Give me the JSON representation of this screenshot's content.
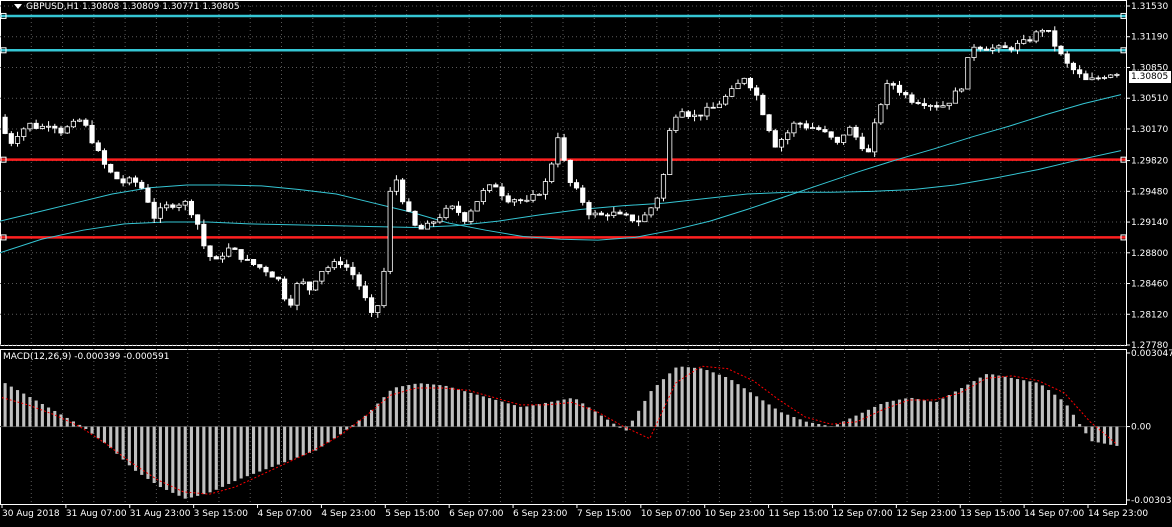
{
  "header": {
    "symbol": "GBPUSD,H1",
    "open": "1.30808",
    "high": "1.30809",
    "low": "1.30771",
    "close": "1.30805"
  },
  "current_price_label": "1.30805",
  "macd": {
    "label": "MACD(12,26,9) -0.000399 -0.000591",
    "axis_labels": [
      "0.003047",
      "0.00",
      "-0.003039"
    ],
    "axis_values": [
      0.003047,
      0,
      -0.003039
    ]
  },
  "colors": {
    "background": "#000000",
    "candle": "#ffffff",
    "resistance_line": "#35c6d4",
    "support_line": "#ff2020",
    "moving_average": "#35c6d4",
    "macd_histogram": "#c0c0c0",
    "macd_signal": "#ff0000",
    "grid": "#5a5a5a"
  },
  "chart_data": {
    "type": "candlestick",
    "symbol": "GBPUSD",
    "timeframe": "H1",
    "price_axis": {
      "labels": [
        "1.31530",
        "1.31190",
        "1.30850",
        "1.30510",
        "1.30170",
        "1.29820",
        "1.29480",
        "1.29140",
        "1.28800",
        "1.28460",
        "1.28120",
        "1.27780"
      ],
      "min": 1.2778,
      "max": 1.3153
    },
    "time_axis": {
      "labels": [
        "30 Aug 2018",
        "31 Aug 07:00",
        "31 Aug 23:00",
        "3 Sep 15:00",
        "4 Sep 07:00",
        "4 Sep 23:00",
        "5 Sep 15:00",
        "6 Sep 07:00",
        "6 Sep 23:00",
        "7 Sep 15:00",
        "10 Sep 07:00",
        "10 Sep 23:00",
        "11 Sep 15:00",
        "12 Sep 07:00",
        "12 Sep 23:00",
        "13 Sep 15:00",
        "14 Sep 07:00",
        "14 Sep 23:00"
      ]
    },
    "horizontal_lines": [
      {
        "price": 1.3142,
        "color": "#35c6d4"
      },
      {
        "price": 1.3104,
        "color": "#35c6d4"
      },
      {
        "price": 1.2983,
        "color": "#ff2020"
      },
      {
        "price": 1.2897,
        "color": "#ff2020"
      }
    ],
    "price_path": [
      1.303,
      1.3,
      1.3015,
      1.3022,
      1.3018,
      1.3025,
      1.3015,
      1.302,
      1.3028,
      1.3005,
      1.298,
      1.2965,
      1.2958,
      1.296,
      1.295,
      1.292,
      1.293,
      1.2935,
      1.2935,
      1.292,
      1.288,
      1.287,
      1.2885,
      1.288,
      1.287,
      1.2865,
      1.286,
      1.285,
      1.282,
      1.285,
      1.284,
      1.286,
      1.2865,
      1.287,
      1.286,
      1.284,
      1.281,
      1.283,
      1.2975,
      1.294,
      1.291,
      1.2905,
      1.2915,
      1.2925,
      1.293,
      1.2918,
      1.2935,
      1.295,
      1.2955,
      1.294,
      1.294,
      1.2935,
      1.2945,
      1.296,
      1.301,
      1.296,
      1.2945,
      1.2925,
      1.292,
      1.2925,
      1.292,
      1.2918,
      1.2915,
      1.293,
      1.295,
      1.303,
      1.304,
      1.303,
      1.3035,
      1.304,
      1.305,
      1.306,
      1.3075,
      1.306,
      1.303,
      1.3,
      1.301,
      1.3025,
      1.302,
      1.3018,
      1.301,
      1.3,
      1.302,
      1.3005,
      1.299,
      1.304,
      1.307,
      1.306,
      1.305,
      1.3048,
      1.3045,
      1.3042,
      1.305,
      1.3065,
      1.311,
      1.3108,
      1.3106,
      1.3105,
      1.3108,
      1.3112,
      1.312,
      1.313,
      1.311,
      1.309,
      1.308,
      1.307,
      1.3072,
      1.3078,
      1.308
    ],
    "ma_fast": [
      1.2915,
      1.2925,
      1.2935,
      1.2945,
      1.2952,
      1.2955,
      1.2955,
      1.2954,
      1.295,
      1.2945,
      1.2935,
      1.2925,
      1.2913,
      1.2905,
      1.2898,
      1.2895,
      1.2894,
      1.2897,
      1.2905,
      1.2915,
      1.2928,
      1.2942,
      1.2956,
      1.297,
      1.2983,
      1.2995,
      1.3008,
      1.302,
      1.3033,
      1.3045,
      1.3055
    ],
    "ma_slow": [
      1.288,
      1.2895,
      1.2905,
      1.2912,
      1.2914,
      1.2914,
      1.2912,
      1.2911,
      1.291,
      1.2909,
      1.2908,
      1.291,
      1.2915,
      1.2922,
      1.2928,
      1.2932,
      1.2935,
      1.294,
      1.2945,
      1.2947,
      1.2947,
      1.2948,
      1.295,
      1.2955,
      1.2963,
      1.2972,
      1.2983,
      1.2993
    ],
    "macd_histogram": [
      0.0018,
      0.0012,
      0.0006,
      0.0,
      -0.0008,
      -0.0018,
      -0.0025,
      -0.003,
      -0.0027,
      -0.0022,
      -0.0018,
      -0.0014,
      -0.001,
      -0.0003,
      0.0005,
      0.0016,
      0.0018,
      0.0017,
      0.0014,
      0.0011,
      0.0008,
      0.001,
      0.0012,
      0.0005,
      -0.0002,
      0.0015,
      0.0025,
      0.0024,
      0.002,
      0.0013,
      0.0006,
      0.0002,
      0.0,
      0.0005,
      0.001,
      0.0012,
      0.001,
      0.0016,
      0.0022,
      0.002,
      0.0018,
      0.001,
      -0.0006,
      -0.0008
    ],
    "macd_signal": [
      0.0012,
      0.0009,
      0.0005,
      0.0,
      -0.0007,
      -0.0015,
      -0.0022,
      -0.0027,
      -0.0028,
      -0.0025,
      -0.002,
      -0.0015,
      -0.001,
      -0.0004,
      0.0004,
      0.0013,
      0.0016,
      0.0016,
      0.0015,
      0.0012,
      0.0009,
      0.0009,
      0.001,
      0.0006,
      0.0,
      -0.0005,
      0.0018,
      0.0025,
      0.0024,
      0.0019,
      0.0011,
      0.0004,
      0.0001,
      0.0002,
      0.0007,
      0.0011,
      0.0011,
      0.0014,
      0.002,
      0.0021,
      0.0019,
      0.0014,
      0.0002,
      -0.0007
    ]
  }
}
